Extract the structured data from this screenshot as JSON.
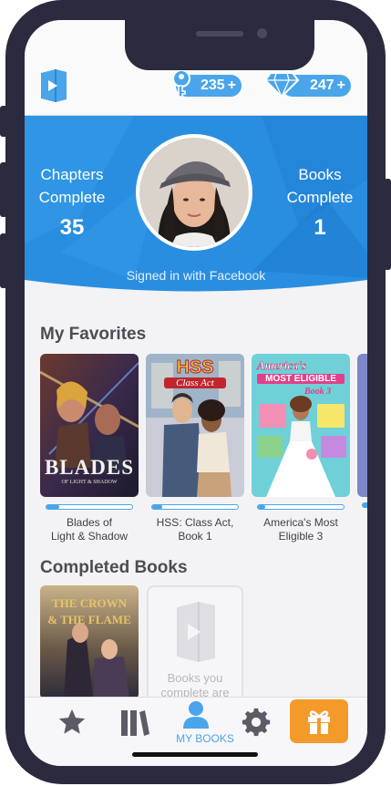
{
  "header": {
    "keys_count": "235",
    "keys_plus": "+",
    "gems_count": "247",
    "gems_plus": "+"
  },
  "profile": {
    "chapters_label_line1": "Chapters",
    "chapters_label_line2": "Complete",
    "chapters_value": "35",
    "books_label_line1": "Books",
    "books_label_line2": "Complete",
    "books_value": "1",
    "signed_in_text": "Signed in with Facebook"
  },
  "favorites": {
    "title": "My Favorites",
    "items": [
      {
        "title_line1": "Blades of",
        "title_line2": "Light & Shadow",
        "progress": 0.15,
        "cover_text_1": "BLADES",
        "cover_text_2": "OF LIGHT & SHADOW"
      },
      {
        "title_line1": "HSS: Class Act,",
        "title_line2": "Book 1",
        "progress": 0.12,
        "cover_text_1": "HSS",
        "cover_text_2": "Class Act"
      },
      {
        "title_line1": "America's Most",
        "title_line2": "Eligible 3",
        "progress": 0.08,
        "cover_text_1": "America's",
        "cover_text_2": "MOST ELIGIBLE",
        "cover_text_3": "Book 3"
      }
    ]
  },
  "completed": {
    "title": "Completed Books",
    "items": [
      {
        "cover_text_1": "THE CROWN",
        "cover_text_2": "& THE FLAME"
      }
    ],
    "placeholder_text_line1": "Books you",
    "placeholder_text_line2": "complete are"
  },
  "tabs": [
    {
      "icon": "star-icon"
    },
    {
      "icon": "library-icon"
    },
    {
      "icon": "person-icon",
      "label": "MY BOOKS",
      "active": true
    },
    {
      "icon": "gear-icon"
    },
    {
      "icon": "gift-icon"
    }
  ],
  "colors": {
    "accent": "#4aa5ea",
    "banner": "#2a8ee0",
    "gift": "#f39a2b",
    "frame": "#2b2a3f"
  }
}
